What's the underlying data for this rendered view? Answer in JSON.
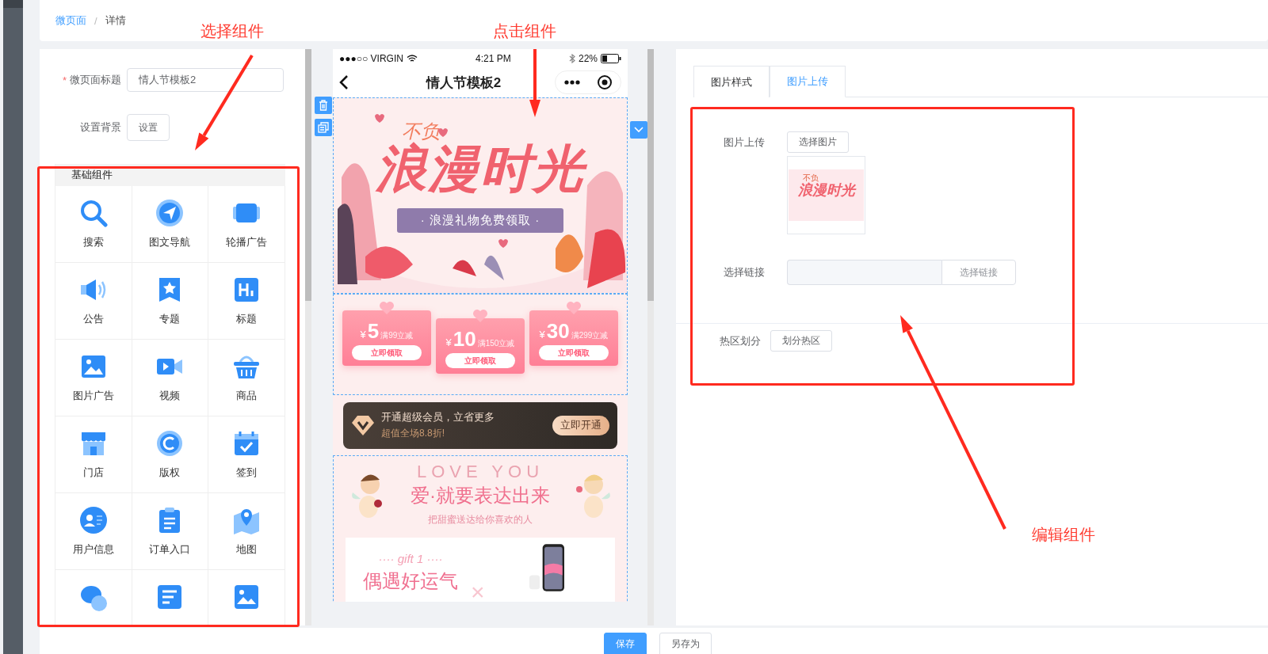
{
  "breadcrumb": {
    "parent": "微页面",
    "separator": "/",
    "current": "详情"
  },
  "settings": {
    "required_mark": "*",
    "title_label": "微页面标题",
    "title_value": "情人节模板2",
    "background_label": "设置背景",
    "background_button": "设置"
  },
  "components": {
    "heading": "基础组件",
    "items": [
      {
        "kind": "search",
        "label": "搜索"
      },
      {
        "kind": "nav",
        "label": "图文导航"
      },
      {
        "kind": "carousel",
        "label": "轮播广告"
      },
      {
        "kind": "notice",
        "label": "公告"
      },
      {
        "kind": "topic",
        "label": "专题"
      },
      {
        "kind": "title",
        "label": "标题"
      },
      {
        "kind": "image_ad",
        "label": "图片广告"
      },
      {
        "kind": "video",
        "label": "视频"
      },
      {
        "kind": "goods",
        "label": "商品"
      },
      {
        "kind": "store",
        "label": "门店"
      },
      {
        "kind": "copyright",
        "label": "版权"
      },
      {
        "kind": "signin",
        "label": "签到"
      },
      {
        "kind": "user",
        "label": "用户信息"
      },
      {
        "kind": "order",
        "label": "订单入口"
      },
      {
        "kind": "map",
        "label": "地图"
      },
      {
        "kind": "chat"
      },
      {
        "kind": "article"
      },
      {
        "kind": "picture"
      }
    ]
  },
  "phone": {
    "status": {
      "carrier": "●●●○○ VIRGIN",
      "time": "4:21 PM",
      "battery": "22%"
    },
    "title": "情人节模板2",
    "banner": {
      "small": "不负",
      "big": "浪漫时光",
      "ribbon": "· 浪漫礼物免费领取 ·"
    },
    "coupons": [
      {
        "currency": "¥",
        "amount": "5",
        "condition": "满99立减",
        "button": "立即领取"
      },
      {
        "currency": "¥",
        "amount": "10",
        "condition": "满150立减",
        "button": "立即领取"
      },
      {
        "currency": "¥",
        "amount": "30",
        "condition": "满299立减",
        "button": "立即领取"
      }
    ],
    "vip": {
      "title": "开通超级会员，立省更多",
      "subtitle": "超值全场8.8折!",
      "button": "立即开通"
    },
    "love": {
      "watermark": "LOVE YOU",
      "title": "爱·就要表达出来",
      "subtitle": "把甜蜜送达给你喜欢的人",
      "gift_label": "···· gift 1 ····",
      "gift_title": "偶遇好运气",
      "times": "×"
    }
  },
  "editor": {
    "tabs": [
      {
        "label": "图片样式",
        "selected": false
      },
      {
        "label": "图片上传",
        "selected": true
      }
    ],
    "upload_label": "图片上传",
    "upload_button": "选择图片",
    "thumbnail": {
      "small": "不负",
      "big": "浪漫时光"
    },
    "link_label": "选择链接",
    "link_button": "选择链接",
    "hotspot_label": "热区划分",
    "hotspot_button": "划分热区"
  },
  "footer": {
    "buttons": [
      {
        "label": "保存",
        "kind": "primary"
      },
      {
        "label": "另存为",
        "kind": "default"
      }
    ]
  },
  "annotations": [
    "选择组件",
    "点击组件",
    "编辑组件"
  ]
}
